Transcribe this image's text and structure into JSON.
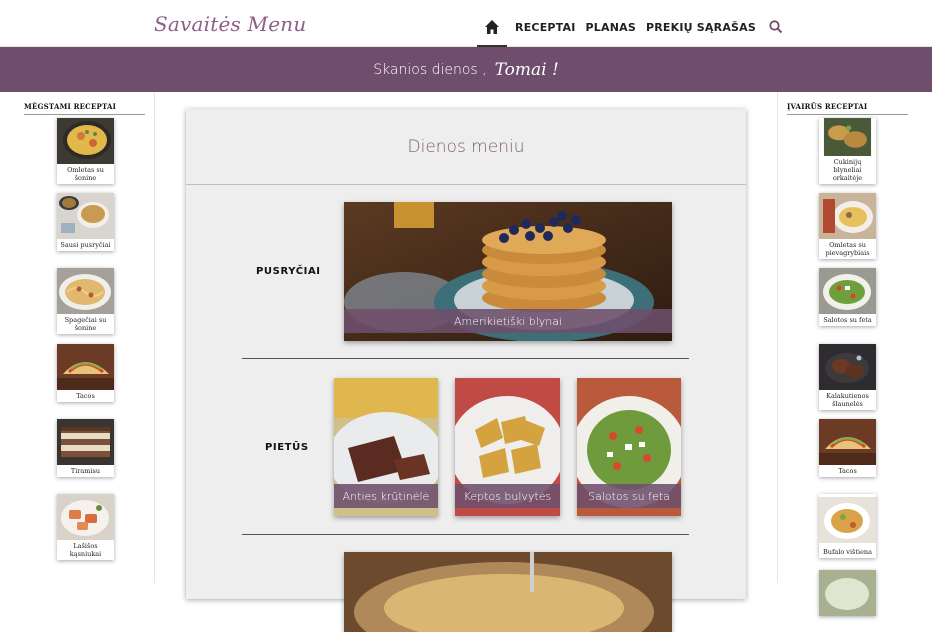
{
  "header": {
    "logo": "Savaitės Menu",
    "nav": [
      "RECEPTAI",
      "PLANAS",
      "PREKIŲ SĄRAŠAS"
    ]
  },
  "band": {
    "greeting": "Skanios dienos ,",
    "name": "Tomai !"
  },
  "favorites": {
    "title": "MĖGSTAMI RECEPTAI",
    "items": [
      "Omletas su šonine",
      "Sausi pusryčiai",
      "Spagečiai su šonine",
      "Tacos",
      "Tiramisu",
      "Lašišos kąsniukai"
    ]
  },
  "various": {
    "title": "ĮVAIRŪS RECEPTAI",
    "items": [
      "Cukinijų blyneliai orkaitėje",
      "Omletas su pievagrybiais",
      "Salotos su feta",
      "Kalakutienos šlaunelės",
      "Tacos",
      "Bufalo vištiena"
    ]
  },
  "menu": {
    "title": "Dienos meniu",
    "breakfast_label": "PUSRYČIAI",
    "breakfast_dish": "Amerikietiški blynai",
    "lunch_label": "PIETŪS",
    "lunch_dishes": [
      "Anties krūtinėlė",
      "Keptos bulvytės",
      "Salotos su feta"
    ]
  }
}
